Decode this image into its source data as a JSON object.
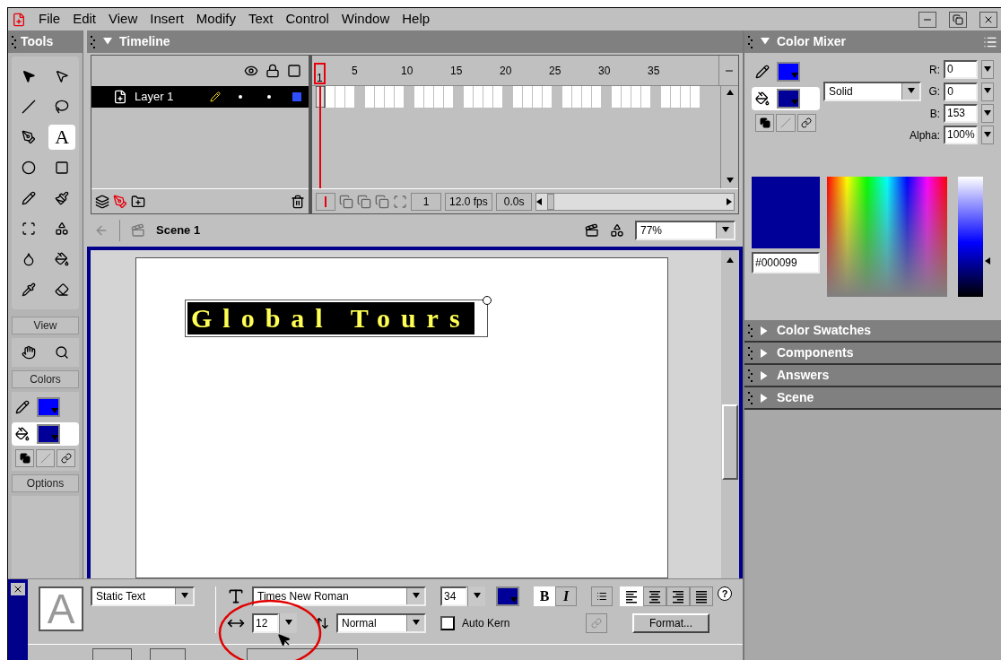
{
  "menu": [
    "File",
    "Edit",
    "View",
    "Insert",
    "Modify",
    "Text",
    "Control",
    "Window",
    "Help"
  ],
  "tools_panel": {
    "title": "Tools",
    "tools": [
      {
        "kind": "arrow",
        "selected": false
      },
      {
        "kind": "subselect",
        "selected": false
      },
      {
        "kind": "line",
        "selected": false
      },
      {
        "kind": "lasso",
        "selected": false
      },
      {
        "kind": "pen",
        "selected": false
      },
      {
        "kind": "text",
        "glyph": "A",
        "selected": true
      },
      {
        "kind": "oval",
        "selected": false
      },
      {
        "kind": "rectangle",
        "selected": false
      },
      {
        "kind": "pencil",
        "selected": false
      },
      {
        "kind": "brush",
        "selected": false
      },
      {
        "kind": "transform",
        "selected": false
      },
      {
        "kind": "gradient",
        "selected": false
      },
      {
        "kind": "ink",
        "selected": false
      },
      {
        "kind": "bucket",
        "selected": false
      },
      {
        "kind": "dropper",
        "selected": false
      },
      {
        "kind": "eraser",
        "selected": false
      }
    ],
    "view_label": "View",
    "colors_label": "Colors",
    "options_label": "Options",
    "colors": [
      {
        "kind": "stroke",
        "color": "#0000ff",
        "selected": false
      },
      {
        "kind": "fill",
        "color": "#000099",
        "selected": true
      }
    ]
  },
  "timeline": {
    "title": "Timeline",
    "expanded": true,
    "ruler": [
      {
        "label": "1",
        "selected": true
      },
      {
        "label": "5",
        "selected": false
      },
      {
        "label": "10",
        "selected": false
      },
      {
        "label": "15",
        "selected": false
      },
      {
        "label": "20",
        "selected": false
      },
      {
        "label": "25",
        "selected": false
      },
      {
        "label": "30",
        "selected": false
      },
      {
        "label": "35",
        "selected": false
      }
    ],
    "layers": [
      {
        "name": "Layer 1",
        "selected": true
      }
    ],
    "current_frame": "1",
    "frame_rate": "12.0 fps",
    "elapsed": "0.0s"
  },
  "scene_bar": {
    "scene": "Scene 1",
    "zoom": "77%"
  },
  "stage": {
    "text": "Global Tours"
  },
  "color_mixer": {
    "title": "Color Mixer",
    "expanded": true,
    "colors": [
      {
        "kind": "stroke",
        "color": "#0000ff",
        "selected": false
      },
      {
        "kind": "fill",
        "color": "#000099",
        "selected": true
      }
    ],
    "fill_type": "Solid",
    "channels": [
      {
        "label": "R:",
        "value": "0"
      },
      {
        "label": "G:",
        "value": "0"
      },
      {
        "label": "B:",
        "value": "153"
      },
      {
        "label": "Alpha:",
        "value": "100%"
      }
    ],
    "hex": "#000099",
    "brightness_slider": {
      "level": 0.3
    }
  },
  "panels": [
    {
      "title": "Color Swatches",
      "expanded": false
    },
    {
      "title": "Components",
      "expanded": false
    },
    {
      "title": "Answers",
      "expanded": false
    },
    {
      "title": "Scene",
      "expanded": false
    }
  ],
  "properties": {
    "preview_glyph": "A",
    "text_type": "Static Text",
    "font": "Times New Roman",
    "size": "34",
    "color": "#000099",
    "styles": [
      {
        "kind": "bold",
        "label": "B",
        "selected": true
      },
      {
        "kind": "italic",
        "label": "I",
        "selected": false
      }
    ],
    "alignments": [
      {
        "kind": "left",
        "selected": true
      },
      {
        "kind": "center",
        "selected": false
      },
      {
        "kind": "right",
        "selected": false
      },
      {
        "kind": "justify",
        "selected": false
      }
    ],
    "tracking": "12",
    "baseline": "Normal",
    "auto_kern_label": "Auto Kern",
    "auto_kern": false,
    "format_button": "Format...",
    "help": "?"
  }
}
